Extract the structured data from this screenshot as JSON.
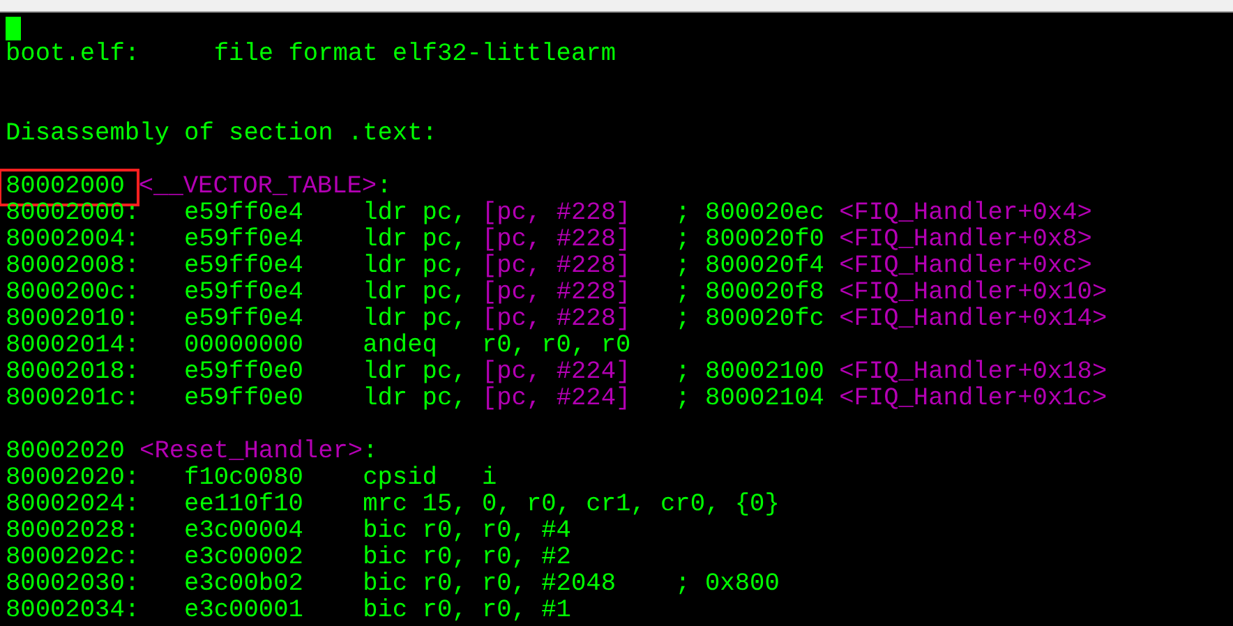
{
  "terminal": {
    "cursor": true,
    "lines": [
      {
        "kind": "header",
        "segments": [
          {
            "text": "boot.elf:     file format elf32-littlearm",
            "color": "#00ff00"
          }
        ]
      },
      {
        "kind": "section",
        "segments": [
          {
            "text": "Disassembly of section .text:",
            "color": "#00ff00"
          }
        ]
      },
      {
        "kind": "label",
        "segments": [
          {
            "text": "80002000",
            "color": "#00ff00",
            "highlighted": true
          },
          {
            "text": "<__VECTOR_TABLE>",
            "color": "#b400b4"
          },
          {
            "text": ":",
            "color": "#00ff00"
          }
        ]
      },
      {
        "kind": "instruction",
        "segments": [
          {
            "text": "80002000:   e59ff0e4    ldr pc, ",
            "color": "#00ff00"
          },
          {
            "text": "[pc, #228]",
            "color": "#b400b4"
          },
          {
            "text": "   ; 800020ec ",
            "color": "#00ff00"
          },
          {
            "text": "<FIQ_Handler+0x4>",
            "color": "#b400b4"
          }
        ]
      },
      {
        "kind": "instruction",
        "segments": [
          {
            "text": "80002004:   e59ff0e4    ldr pc, ",
            "color": "#00ff00"
          },
          {
            "text": "[pc, #228]",
            "color": "#b400b4"
          },
          {
            "text": "   ; 800020f0 ",
            "color": "#00ff00"
          },
          {
            "text": "<FIQ_Handler+0x8>",
            "color": "#b400b4"
          }
        ]
      },
      {
        "kind": "instruction",
        "segments": [
          {
            "text": "80002008:   e59ff0e4    ldr pc, ",
            "color": "#00ff00"
          },
          {
            "text": "[pc, #228]",
            "color": "#b400b4"
          },
          {
            "text": "   ; 800020f4 ",
            "color": "#00ff00"
          },
          {
            "text": "<FIQ_Handler+0xc>",
            "color": "#b400b4"
          }
        ]
      },
      {
        "kind": "instruction",
        "segments": [
          {
            "text": "8000200c:   e59ff0e4    ldr pc, ",
            "color": "#00ff00"
          },
          {
            "text": "[pc, #228]",
            "color": "#b400b4"
          },
          {
            "text": "   ; 800020f8 ",
            "color": "#00ff00"
          },
          {
            "text": "<FIQ_Handler+0x10>",
            "color": "#b400b4"
          }
        ]
      },
      {
        "kind": "instruction",
        "segments": [
          {
            "text": "80002010:   e59ff0e4    ldr pc, ",
            "color": "#00ff00"
          },
          {
            "text": "[pc, #228]",
            "color": "#b400b4"
          },
          {
            "text": "   ; 800020fc ",
            "color": "#00ff00"
          },
          {
            "text": "<FIQ_Handler+0x14>",
            "color": "#b400b4"
          }
        ]
      },
      {
        "kind": "instruction",
        "segments": [
          {
            "text": "80002014:   00000000    andeq   r0, r0, r0",
            "color": "#00ff00"
          }
        ]
      },
      {
        "kind": "instruction",
        "segments": [
          {
            "text": "80002018:   e59ff0e0    ldr pc, ",
            "color": "#00ff00"
          },
          {
            "text": "[pc, #224]",
            "color": "#b400b4"
          },
          {
            "text": "   ; 80002100 ",
            "color": "#00ff00"
          },
          {
            "text": "<FIQ_Handler+0x18>",
            "color": "#b400b4"
          }
        ]
      },
      {
        "kind": "instruction",
        "segments": [
          {
            "text": "8000201c:   e59ff0e0    ldr pc, ",
            "color": "#00ff00"
          },
          {
            "text": "[pc, #224]",
            "color": "#b400b4"
          },
          {
            "text": "   ; 80002104 ",
            "color": "#00ff00"
          },
          {
            "text": "<FIQ_Handler+0x1c>",
            "color": "#b400b4"
          }
        ]
      },
      {
        "kind": "label",
        "segments": [
          {
            "text": "80002020 ",
            "color": "#00ff00"
          },
          {
            "text": "<Reset_Handler>",
            "color": "#b400b4"
          },
          {
            "text": ":",
            "color": "#00ff00"
          }
        ]
      },
      {
        "kind": "instruction",
        "segments": [
          {
            "text": "80002020:   f10c0080    cpsid   i",
            "color": "#00ff00"
          }
        ]
      },
      {
        "kind": "instruction",
        "segments": [
          {
            "text": "80002024:   ee110f10    mrc 15, 0, r0, cr1, cr0, {0}",
            "color": "#00ff00"
          }
        ]
      },
      {
        "kind": "instruction",
        "segments": [
          {
            "text": "80002028:   e3c00004    bic r0, r0, #4",
            "color": "#00ff00"
          }
        ]
      },
      {
        "kind": "instruction",
        "segments": [
          {
            "text": "8000202c:   e3c00002    bic r0, r0, #2",
            "color": "#00ff00"
          }
        ]
      },
      {
        "kind": "instruction",
        "segments": [
          {
            "text": "80002030:   e3c00b02    bic r0, r0, #2048    ; 0x800",
            "color": "#00ff00"
          }
        ]
      },
      {
        "kind": "instruction",
        "segments": [
          {
            "text": "80002034:   e3c00001    bic r0, r0, #1",
            "color": "#00ff00"
          }
        ]
      }
    ]
  }
}
